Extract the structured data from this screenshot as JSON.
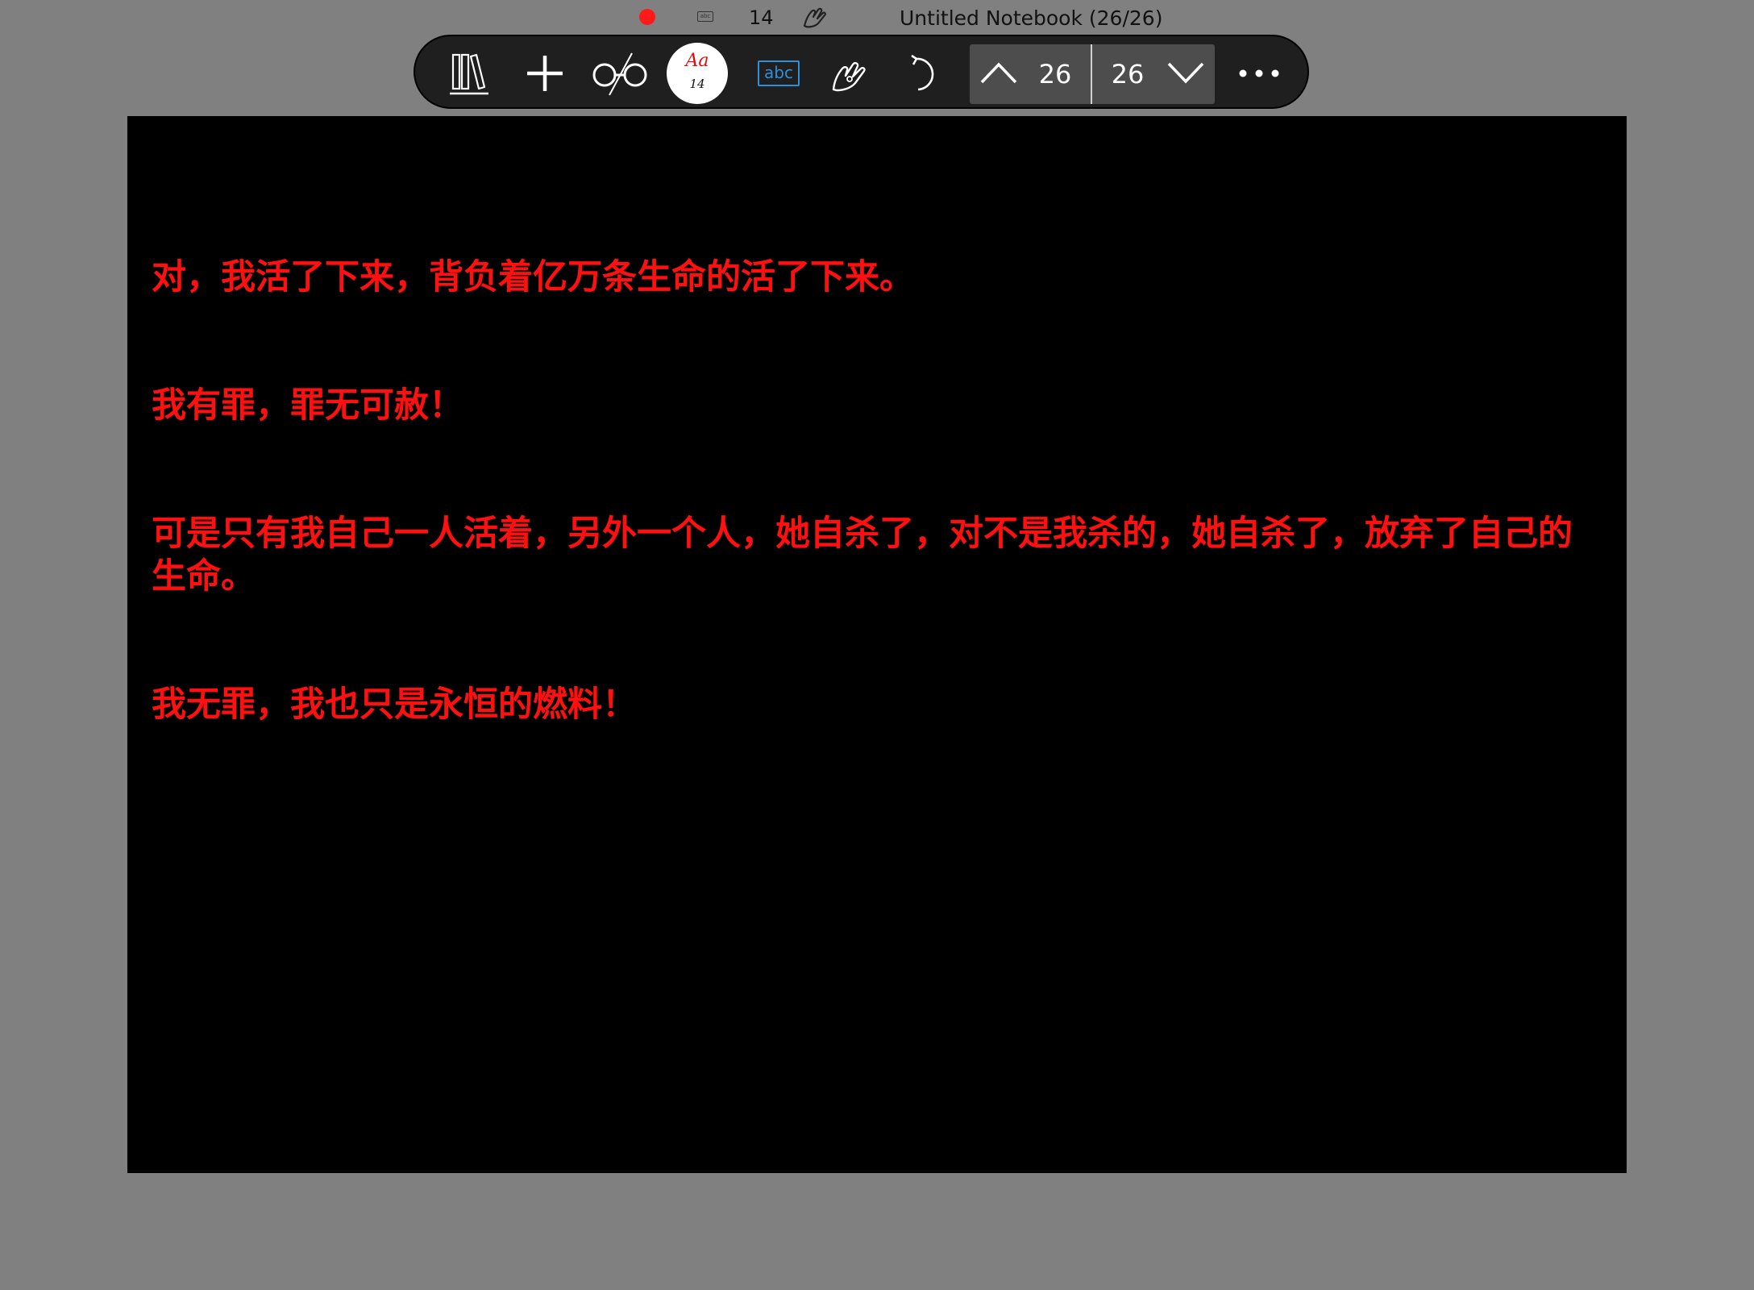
{
  "status_bar": {
    "recording_color": "#ff1a1a",
    "mini_tool_icon": "abc-textbox-icon",
    "font_size": "14",
    "mini_gesture_icon": "hand-pen-icon",
    "window_title": "Untitled Notebook (26/26)"
  },
  "toolbar": {
    "icons": [
      "library-icon",
      "add-icon",
      "glasses-icon",
      "font-style-icon",
      "textbox-icon",
      "hand-gesture-icon",
      "undo-icon",
      "more-icon"
    ],
    "font_button": {
      "sample": "Aa",
      "size": "14",
      "sample_color": "#e01010"
    },
    "textbox_label": "abc",
    "pager": {
      "current_page": "26",
      "total_pages": "26"
    }
  },
  "page": {
    "background": "#000000",
    "text_color": "#ff1010",
    "lines": [
      "对，我活了下来，背负着亿万条生命的活了下来。",
      "我有罪，罪无可赦！",
      "可是只有我自己一人活着，另外一个人，她自杀了，对不是我杀的，她自杀了，放弃了自己的生命。",
      "我无罪，我也只是永恒的燃料！"
    ]
  }
}
